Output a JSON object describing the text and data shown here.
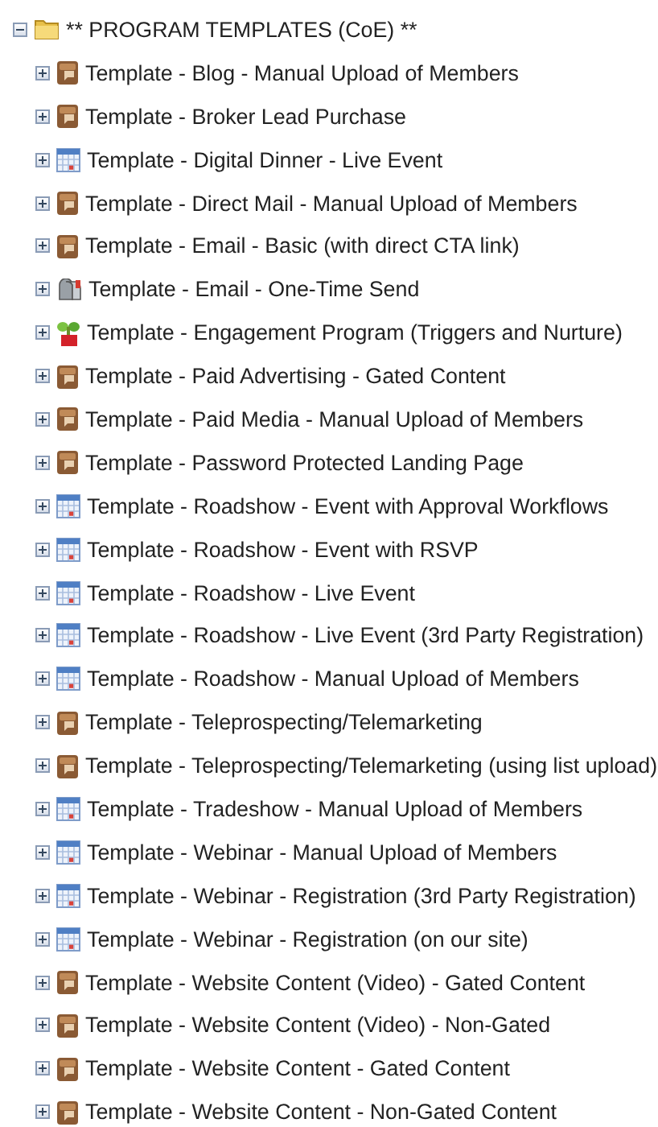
{
  "tree": {
    "label": "** PROGRAM TEMPLATES (CoE) **",
    "kind": "folder",
    "expanded": true,
    "children": [
      {
        "label": "Template - Blog - Manual Upload of Members",
        "kind": "program",
        "expanded": false
      },
      {
        "label": "Template - Broker Lead Purchase",
        "kind": "program",
        "expanded": false
      },
      {
        "label": "Template - Digital Dinner - Live Event",
        "kind": "event",
        "expanded": false
      },
      {
        "label": "Template - Direct Mail - Manual Upload of Members",
        "kind": "program",
        "expanded": false
      },
      {
        "label": "Template - Email - Basic (with direct CTA link)",
        "kind": "program",
        "expanded": false
      },
      {
        "label": "Template - Email - One-Time Send",
        "kind": "email",
        "expanded": false
      },
      {
        "label": "Template - Engagement Program (Triggers and Nurture)",
        "kind": "engagement",
        "expanded": false
      },
      {
        "label": "Template - Paid Advertising - Gated Content",
        "kind": "program",
        "expanded": false
      },
      {
        "label": "Template - Paid Media - Manual Upload of Members",
        "kind": "program",
        "expanded": false
      },
      {
        "label": "Template - Password Protected Landing Page",
        "kind": "program",
        "expanded": false
      },
      {
        "label": "Template - Roadshow - Event with Approval Workflows",
        "kind": "event",
        "expanded": false
      },
      {
        "label": "Template - Roadshow - Event with RSVP",
        "kind": "event",
        "expanded": false
      },
      {
        "label": "Template - Roadshow - Live Event",
        "kind": "event",
        "expanded": false
      },
      {
        "label": "Template - Roadshow - Live Event (3rd Party Registration)",
        "kind": "event",
        "expanded": false
      },
      {
        "label": "Template - Roadshow - Manual Upload of Members",
        "kind": "event",
        "expanded": false
      },
      {
        "label": "Template - Teleprospecting/Telemarketing",
        "kind": "program",
        "expanded": false
      },
      {
        "label": "Template - Teleprospecting/Telemarketing (using list upload)",
        "kind": "program",
        "expanded": false
      },
      {
        "label": "Template - Tradeshow - Manual Upload of Members",
        "kind": "event",
        "expanded": false
      },
      {
        "label": "Template - Webinar - Manual Upload of Members",
        "kind": "event",
        "expanded": false
      },
      {
        "label": "Template - Webinar - Registration (3rd Party Registration)",
        "kind": "event",
        "expanded": false
      },
      {
        "label": "Template - Webinar - Registration (on our site)",
        "kind": "event",
        "expanded": false
      },
      {
        "label": "Template - Website Content (Video) - Gated Content",
        "kind": "program",
        "expanded": false
      },
      {
        "label": "Template - Website Content (Video) - Non-Gated",
        "kind": "program",
        "expanded": false
      },
      {
        "label": "Template - Website Content - Gated Content",
        "kind": "program",
        "expanded": false
      },
      {
        "label": "Template - Website Content - Non-Gated Content",
        "kind": "program",
        "expanded": false
      }
    ]
  }
}
